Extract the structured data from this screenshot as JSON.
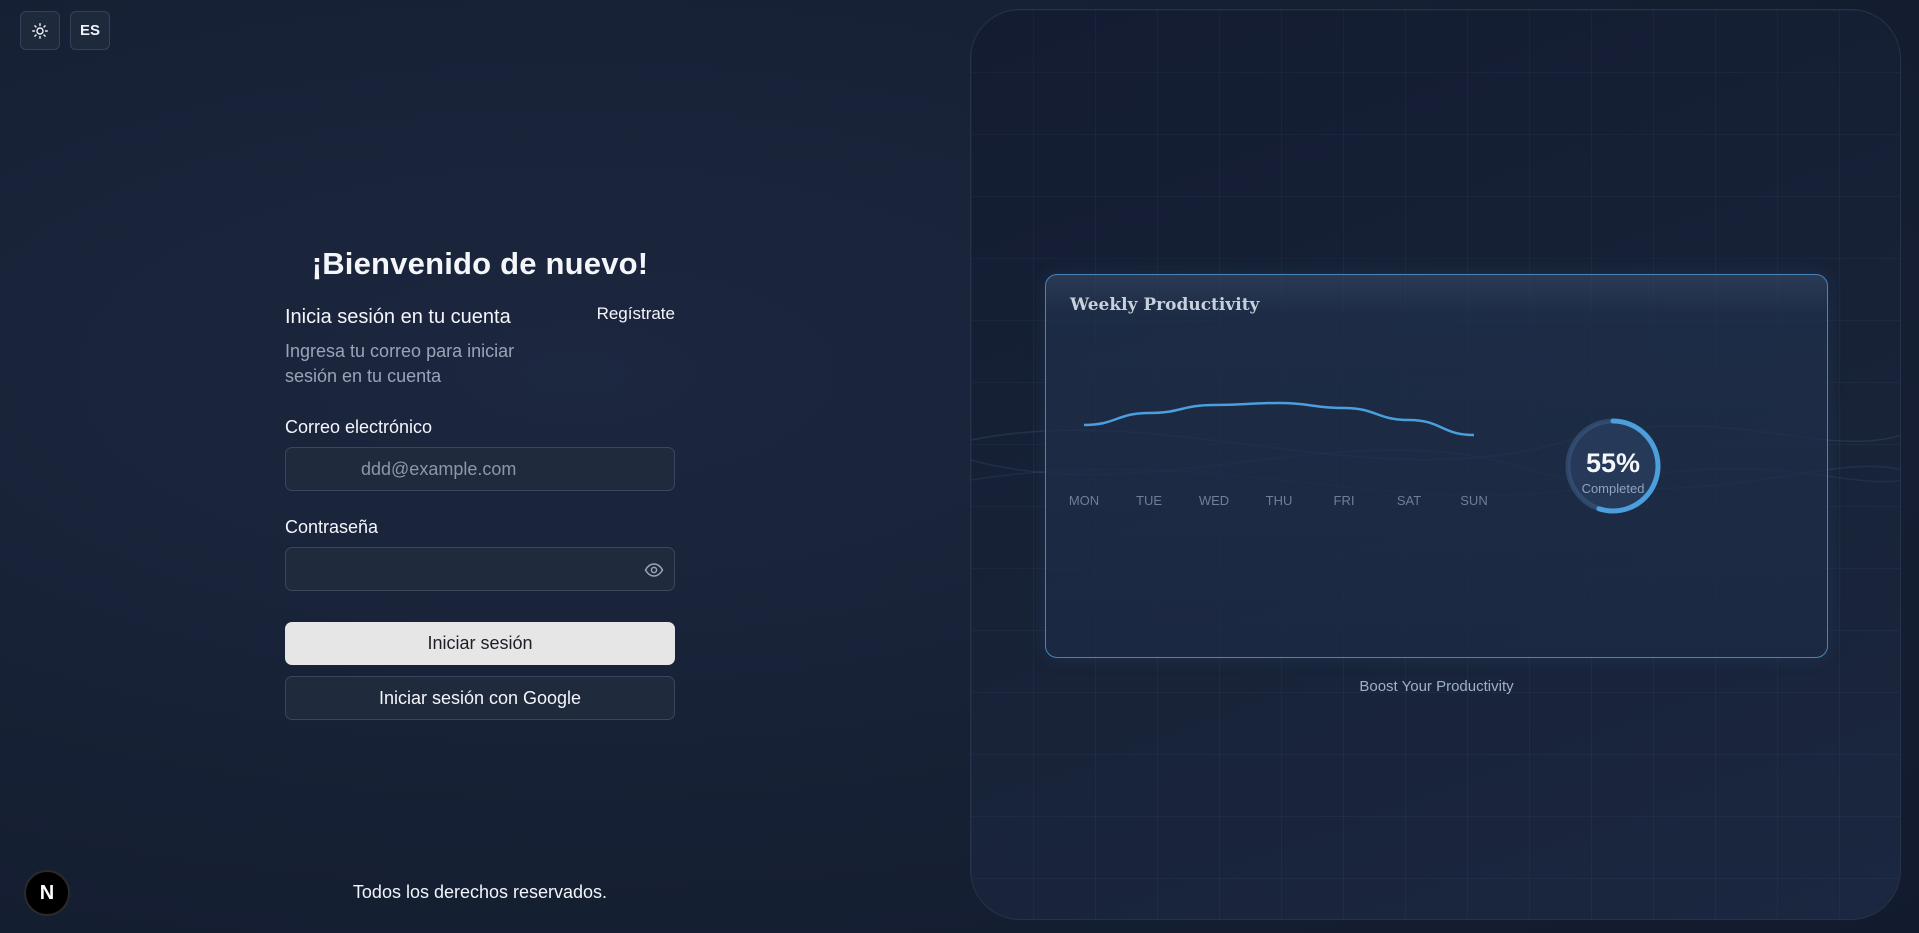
{
  "controls": {
    "theme_icon": "sun-icon",
    "language": "ES"
  },
  "login": {
    "welcome": "¡Bienvenido de nuevo!",
    "title": "Inicia sesión en tu cuenta",
    "register": "Regístrate",
    "subtitle": "Ingresa tu correo para iniciar sesión en tu cuenta",
    "email_label": "Correo electrónico",
    "email_placeholder": "ddd@example.com",
    "password_label": "Contraseña",
    "password_value": "",
    "eye_icon": "eye-icon",
    "submit": "Iniciar sesión",
    "google": "Iniciar sesión con Google"
  },
  "footer": {
    "copyright": "Todos los derechos reservados.",
    "badge": "N"
  },
  "promo": {
    "card_title": "Weekly Productivity",
    "tagline": "Boost Your Productivity",
    "progress_percent": 55,
    "progress_label": "55%",
    "progress_caption": "Completed",
    "accent_color": "#4a9fdc"
  },
  "chart_data": {
    "type": "line",
    "categories": [
      "MON",
      "TUE",
      "WED",
      "THU",
      "FRI",
      "SAT",
      "SUN"
    ],
    "values": [
      30,
      42,
      50,
      52,
      47,
      35,
      20
    ],
    "ylim": [
      0,
      60
    ],
    "title": "Weekly Productivity",
    "grid": false
  }
}
